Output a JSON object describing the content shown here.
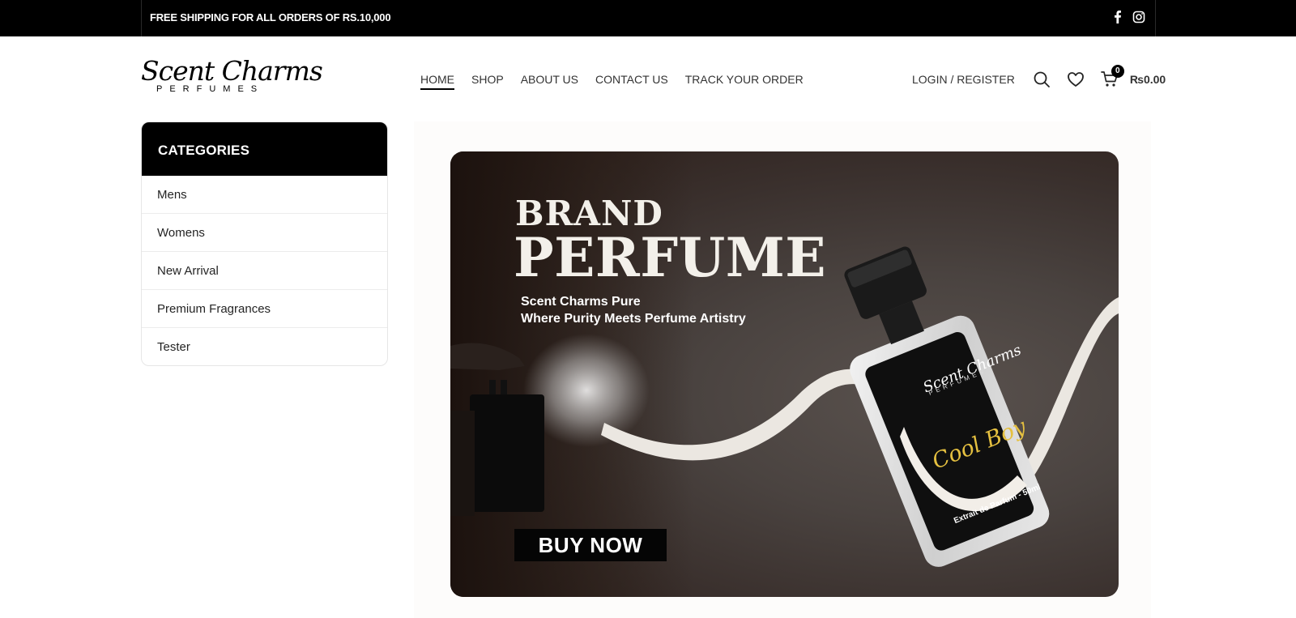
{
  "topbar": {
    "shipping_text": "FREE SHIPPING FOR ALL ORDERS OF RS.10,000",
    "social_icons": [
      "facebook-icon",
      "instagram-icon"
    ]
  },
  "header": {
    "logo_script": "Scent Charms",
    "logo_sub": "PERFUMES",
    "nav": [
      {
        "label": "HOME",
        "active": true
      },
      {
        "label": "SHOP"
      },
      {
        "label": "ABOUT US"
      },
      {
        "label": "CONTACT US"
      },
      {
        "label": "TRACK YOUR ORDER"
      }
    ],
    "login_label": "LOGIN / REGISTER",
    "cart_count": "0",
    "cart_total": "₨0.00",
    "icons": [
      "search-icon",
      "heart-icon",
      "cart-icon"
    ]
  },
  "categories": {
    "title": "CATEGORIES",
    "items": [
      "Mens",
      "Womens",
      "New Arrival",
      "Premium Fragrances",
      "Tester"
    ]
  },
  "banner": {
    "title_line1": "BRAND",
    "title_line2": "PERFUME",
    "subtitle_line1": "Scent Charms Pure",
    "subtitle_line2": "Where Purity Meets Perfume Artistry",
    "cta_label": "BUY NOW",
    "bottle_brand": "Scent Charms",
    "bottle_brand_sub": "PERFUMES",
    "bottle_name": "Cool Boy",
    "bottle_volume": "Extrait de Parfum - 50ml"
  },
  "colors": {
    "topbar_bg": "#000000",
    "accent": "#000000",
    "banner_bg": "#4a4340",
    "label_gold": "#e5c040"
  }
}
